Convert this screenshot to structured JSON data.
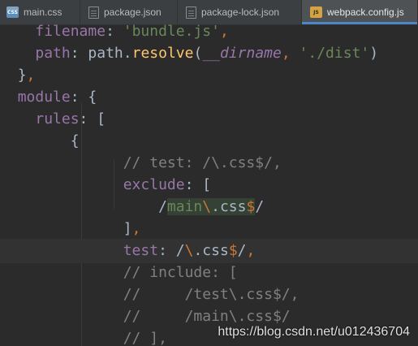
{
  "tabs": [
    {
      "label": "main.css",
      "icon": "css-file-icon",
      "icon_text": "CSS"
    },
    {
      "label": "package.json",
      "icon": "json-file-icon",
      "icon_text": ""
    },
    {
      "label": "package-lock.json",
      "icon": "json-file-icon",
      "icon_text": ""
    },
    {
      "label": "webpack.config.js",
      "icon": "js-file-icon",
      "icon_text": "JS",
      "active": true
    }
  ],
  "code": {
    "l1": {
      "key": "filename",
      "colon": ": ",
      "value": "'bundle.js'",
      "comma": ","
    },
    "l2": {
      "key": "path",
      "colon": ": ",
      "obj": "path",
      "dot": ".",
      "fn": "resolve",
      "open": "(",
      "arg1": "__dirname",
      "sep": ", ",
      "arg2": "'./dist'",
      "close": ")"
    },
    "l3": {
      "brace": "}",
      "comma": ","
    },
    "l4": {
      "key": "module",
      "colon": ": ",
      "brace": "{"
    },
    "l5": {
      "key": "rules",
      "colon": ": ",
      "bracket": "["
    },
    "l6": {
      "brace": "{"
    },
    "l7": {
      "comment": "// test: /\\.css$/,"
    },
    "l8": {
      "key": "exclude",
      "colon": ": ",
      "bracket": "["
    },
    "l9": {
      "slash1": "/",
      "word": "main",
      "esc": "\\",
      "rest": ".css",
      "dollar": "$",
      "slash2": "/"
    },
    "l10": {
      "bracket": "]",
      "comma": ","
    },
    "l11": {
      "key": "test",
      "colon": ": ",
      "slash1": "/",
      "esc": "\\",
      "rest": ".css",
      "dollar": "$",
      "slash2": "/",
      "comma": ","
    },
    "l12": {
      "comment": "// include: ["
    },
    "l13": {
      "comment": "//     /test\\.css$/,"
    },
    "l14": {
      "comment": "//     /main\\.css$/"
    },
    "l15": {
      "comment": "// ],"
    }
  },
  "watermark": "https://blog.csdn.net/u012436704",
  "colors": {
    "background": "#2b2b2b",
    "property": "#9876aa",
    "string": "#6a8759",
    "keyword": "#cc7832",
    "function": "#ffc66d",
    "comment": "#808080",
    "accent": "#4a88c7"
  }
}
